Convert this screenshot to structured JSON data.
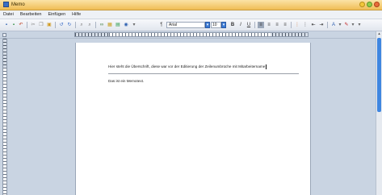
{
  "window": {
    "title": "Memo"
  },
  "menu": {
    "items": [
      "Datei",
      "Bearbeiten",
      "Einfügen",
      "Hilfe"
    ]
  },
  "toolbar": {
    "font_name": "Arial",
    "font_size": "10",
    "bold_label": "B",
    "italic_label": "I",
    "underline_label": "U"
  },
  "document": {
    "line1": "Hier steht die Überschrift, diese war vor der Editierung der Zeilenumbrüche mit Mitarbeitername",
    "line2": "Das ist ein Memotext."
  },
  "colors": {
    "titlebar": "#f0bd55",
    "scroll_thumb": "#3f86e0",
    "workspace": "#c9d4e2"
  }
}
